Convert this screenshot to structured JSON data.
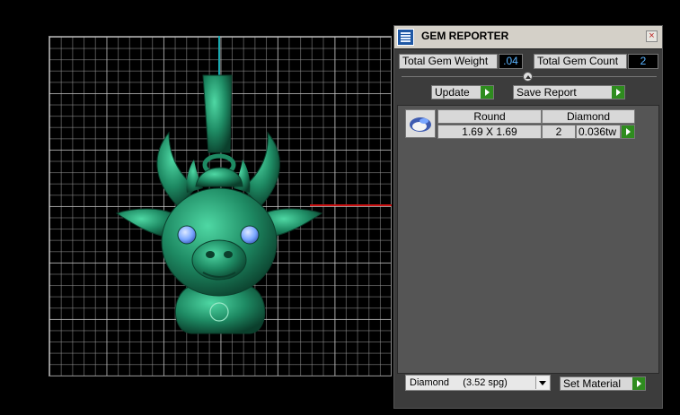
{
  "panel": {
    "title": "GEM REPORTER",
    "close_label": "×",
    "total_weight_label": "Total Gem Weight",
    "total_weight_value": ".04",
    "total_count_label": "Total Gem Count",
    "total_count_value": "2",
    "update_label": "Update",
    "save_report_label": "Save Report",
    "table": {
      "headers": [
        "Round",
        "Diamond"
      ],
      "row": {
        "size": "1.69 X 1.69",
        "count": "2",
        "weight": "0.036tw"
      }
    },
    "material_select_value": "Diamond     (3.52 spg)",
    "set_material_label": "Set Material"
  },
  "colors": {
    "model": "#1e8a63",
    "gem": "#7aa7ff",
    "accent_green": "#2e8c1e",
    "value_text": "#5ab4ff"
  },
  "icons": [
    "gem-reporter-icon",
    "close-icon",
    "run-arrow-icon",
    "gem-thumbnail-icon",
    "dropdown-arrow-icon"
  ]
}
